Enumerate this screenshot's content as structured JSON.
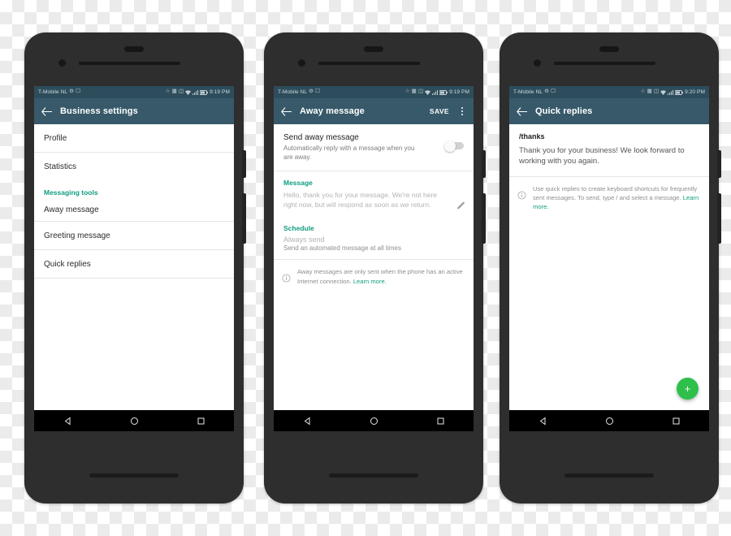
{
  "phones": [
    {
      "name": "business-settings",
      "statusbar": {
        "carrier": "T-Mobile  NL",
        "icons": [
          "alarm-icon",
          "screenshot-icon",
          "bluetooth-icon",
          "sim-icon",
          "vibrate-icon",
          "wifi-icon",
          "signal-icon",
          "battery-icon"
        ],
        "time": "9:19 PM"
      },
      "toolbar": {
        "title": "Business settings",
        "back": "back-arrow-icon"
      },
      "list": [
        {
          "label": "Profile"
        },
        {
          "label": "Statistics"
        }
      ],
      "section_label": "Messaging tools",
      "messaging_list": [
        {
          "label": "Away message"
        },
        {
          "label": "Greeting message"
        },
        {
          "label": "Quick replies"
        }
      ]
    },
    {
      "name": "away-message",
      "statusbar": {
        "carrier": "T-Mobile  NL",
        "time": "9:19 PM"
      },
      "toolbar": {
        "title": "Away message",
        "save_label": "SAVE",
        "back": "back-arrow-icon",
        "more": "overflow-menu-icon"
      },
      "toggle_row": {
        "title": "Send away message",
        "subtitle": "Automatically reply with a message when you are away.",
        "switch_state": "off"
      },
      "message_section": {
        "heading": "Message",
        "text": "Hello, thank you for your message. We're not here right now, but will respond as soon as we return.",
        "edit_icon": "pencil-icon"
      },
      "schedule_section": {
        "heading": "Schedule",
        "value": "Always send",
        "description": "Send an automated message at all times"
      },
      "info": {
        "text": "Away messages are only sent when the phone has an active Internet connection.",
        "link": "Learn more."
      }
    },
    {
      "name": "quick-replies",
      "statusbar": {
        "carrier": "T-Mobile  NL",
        "time": "9:20 PM"
      },
      "toolbar": {
        "title": "Quick replies",
        "back": "back-arrow-icon"
      },
      "reply": {
        "shortcut": "/thanks",
        "text": "Thank you for your business! We look forward to working with you again."
      },
      "info": {
        "text": "Use quick replies to create keyboard shortcuts for frequently sent messages. To send, type / and select a message.",
        "link": "Learn more."
      },
      "fab": {
        "icon": "plus-icon",
        "label": "+"
      }
    }
  ],
  "colors": {
    "toolbar": "#37596a",
    "statusbar": "#2e4d5c",
    "accent_green": "#0f9d7f",
    "fab_green": "#2ec04a",
    "navbar": "#000000"
  }
}
